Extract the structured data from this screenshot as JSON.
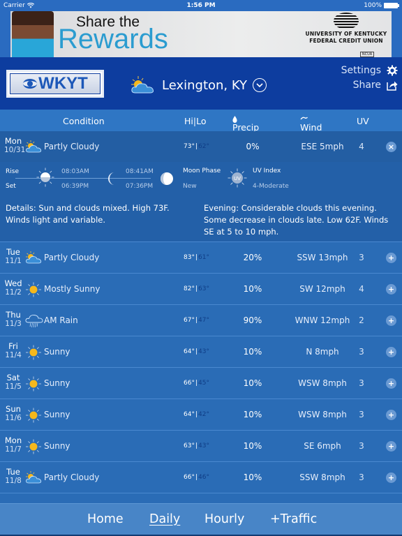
{
  "status_bar": {
    "carrier": "Carrier",
    "time": "1:56 PM",
    "battery": "100%"
  },
  "ad": {
    "line1": "Share the",
    "line2": "Rewards",
    "sponsor_line1": "University of Kentucky",
    "sponsor_line2": "Federal Credit Union",
    "badge": "NCUA"
  },
  "header": {
    "logo_text": "WKYT",
    "location": "Lexington, KY",
    "location_icon": "partly-cloudy-icon",
    "settings_label": "Settings",
    "share_label": "Share"
  },
  "columns": {
    "condition": "Condition",
    "hilo": "Hi|Lo",
    "precip": "Precip",
    "wind": "Wind",
    "uv": "UV"
  },
  "forecast": [
    {
      "day": "Mon",
      "date": "10/31",
      "icon": "partly-cloudy",
      "condition": "Partly Cloudy",
      "hi": "73°",
      "lo": "62°",
      "precip": "0%",
      "wind": "ESE 5mph",
      "uv": "4",
      "expanded": true
    },
    {
      "day": "Tue",
      "date": "11/1",
      "icon": "partly-cloudy",
      "condition": "Partly Cloudy",
      "hi": "83°",
      "lo": "61°",
      "precip": "20%",
      "wind": "SSW 13mph",
      "uv": "3"
    },
    {
      "day": "Wed",
      "date": "11/2",
      "icon": "sunny",
      "condition": "Mostly Sunny",
      "hi": "82°",
      "lo": "63°",
      "precip": "10%",
      "wind": "SW 12mph",
      "uv": "4"
    },
    {
      "day": "Thu",
      "date": "11/3",
      "icon": "rain",
      "condition": "AM Rain",
      "hi": "67°",
      "lo": "47°",
      "precip": "90%",
      "wind": "WNW 12mph",
      "uv": "2"
    },
    {
      "day": "Fri",
      "date": "11/4",
      "icon": "sunny",
      "condition": "Sunny",
      "hi": "64°",
      "lo": "43°",
      "precip": "10%",
      "wind": "N 8mph",
      "uv": "3"
    },
    {
      "day": "Sat",
      "date": "11/5",
      "icon": "sunny",
      "condition": "Sunny",
      "hi": "66°",
      "lo": "45°",
      "precip": "10%",
      "wind": "WSW 8mph",
      "uv": "3"
    },
    {
      "day": "Sun",
      "date": "11/6",
      "icon": "sunny",
      "condition": "Sunny",
      "hi": "64°",
      "lo": "42°",
      "precip": "10%",
      "wind": "WSW 8mph",
      "uv": "3"
    },
    {
      "day": "Mon",
      "date": "11/7",
      "icon": "sunny",
      "condition": "Sunny",
      "hi": "63°",
      "lo": "43°",
      "precip": "10%",
      "wind": "SE 6mph",
      "uv": "3"
    },
    {
      "day": "Tue",
      "date": "11/8",
      "icon": "partly-cloudy",
      "condition": "Partly Cloudy",
      "hi": "66°",
      "lo": "46°",
      "precip": "10%",
      "wind": "SSW 8mph",
      "uv": "3"
    }
  ],
  "detail": {
    "rise_label": "Rise",
    "set_label": "Set",
    "sunrise": "08:03AM",
    "sunset": "06:39PM",
    "moonrise": "08:41AM",
    "moonset": "07:36PM",
    "moon_phase_label": "Moon Phase",
    "moon_phase": "New",
    "uv_index_label": "UV Index",
    "uv_badge": "UV",
    "uv_index": "4-Moderate",
    "details": "Details: Sun and clouds mixed. High 73F. Winds light and variable.",
    "evening": "Evening: Considerable clouds this evening. Some decrease in clouds late. Low 62F. Winds SE at 5 to 10 mph."
  },
  "toggle": {
    "expand": "+",
    "collapse": "×"
  },
  "bottom_nav": {
    "items": [
      "Home",
      "Daily",
      "Hourly",
      "+Traffic"
    ],
    "active": "Daily"
  },
  "colors": {
    "header_bg": "#0d3d9f",
    "row_bg": "#2a6cb6",
    "expanded_bg": "#235ea3",
    "sun": "#f5b81c",
    "low_temp": "#0f3d86"
  }
}
